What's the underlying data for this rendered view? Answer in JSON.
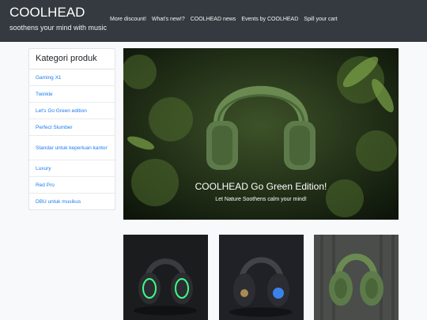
{
  "brand": {
    "title": "COOLHEAD",
    "tagline": "soothens your mind with music"
  },
  "nav": {
    "links": [
      "More discount!",
      "What's new!?",
      "COOLHEAD news",
      "Events by COOLHEAD",
      "Spill your cart"
    ]
  },
  "sidebar": {
    "title": "Kategori produk",
    "items": [
      "Gaming X1",
      "Twinkle",
      "Let's Go Green edition",
      "Perfect Slumber",
      "Standar untuk keperluan kantor",
      "Luxury",
      "Red Pro",
      "DBU untuk musikus"
    ]
  },
  "hero": {
    "title": "COOLHEAD Go Green Edition!",
    "subtitle": "Let Nature Soothens calm your mind!"
  },
  "colors": {
    "navbar": "#343a40",
    "link": "#1a7cf0",
    "hero_green": "#5d7b4a"
  },
  "icons": [
    "headphones-image"
  ]
}
